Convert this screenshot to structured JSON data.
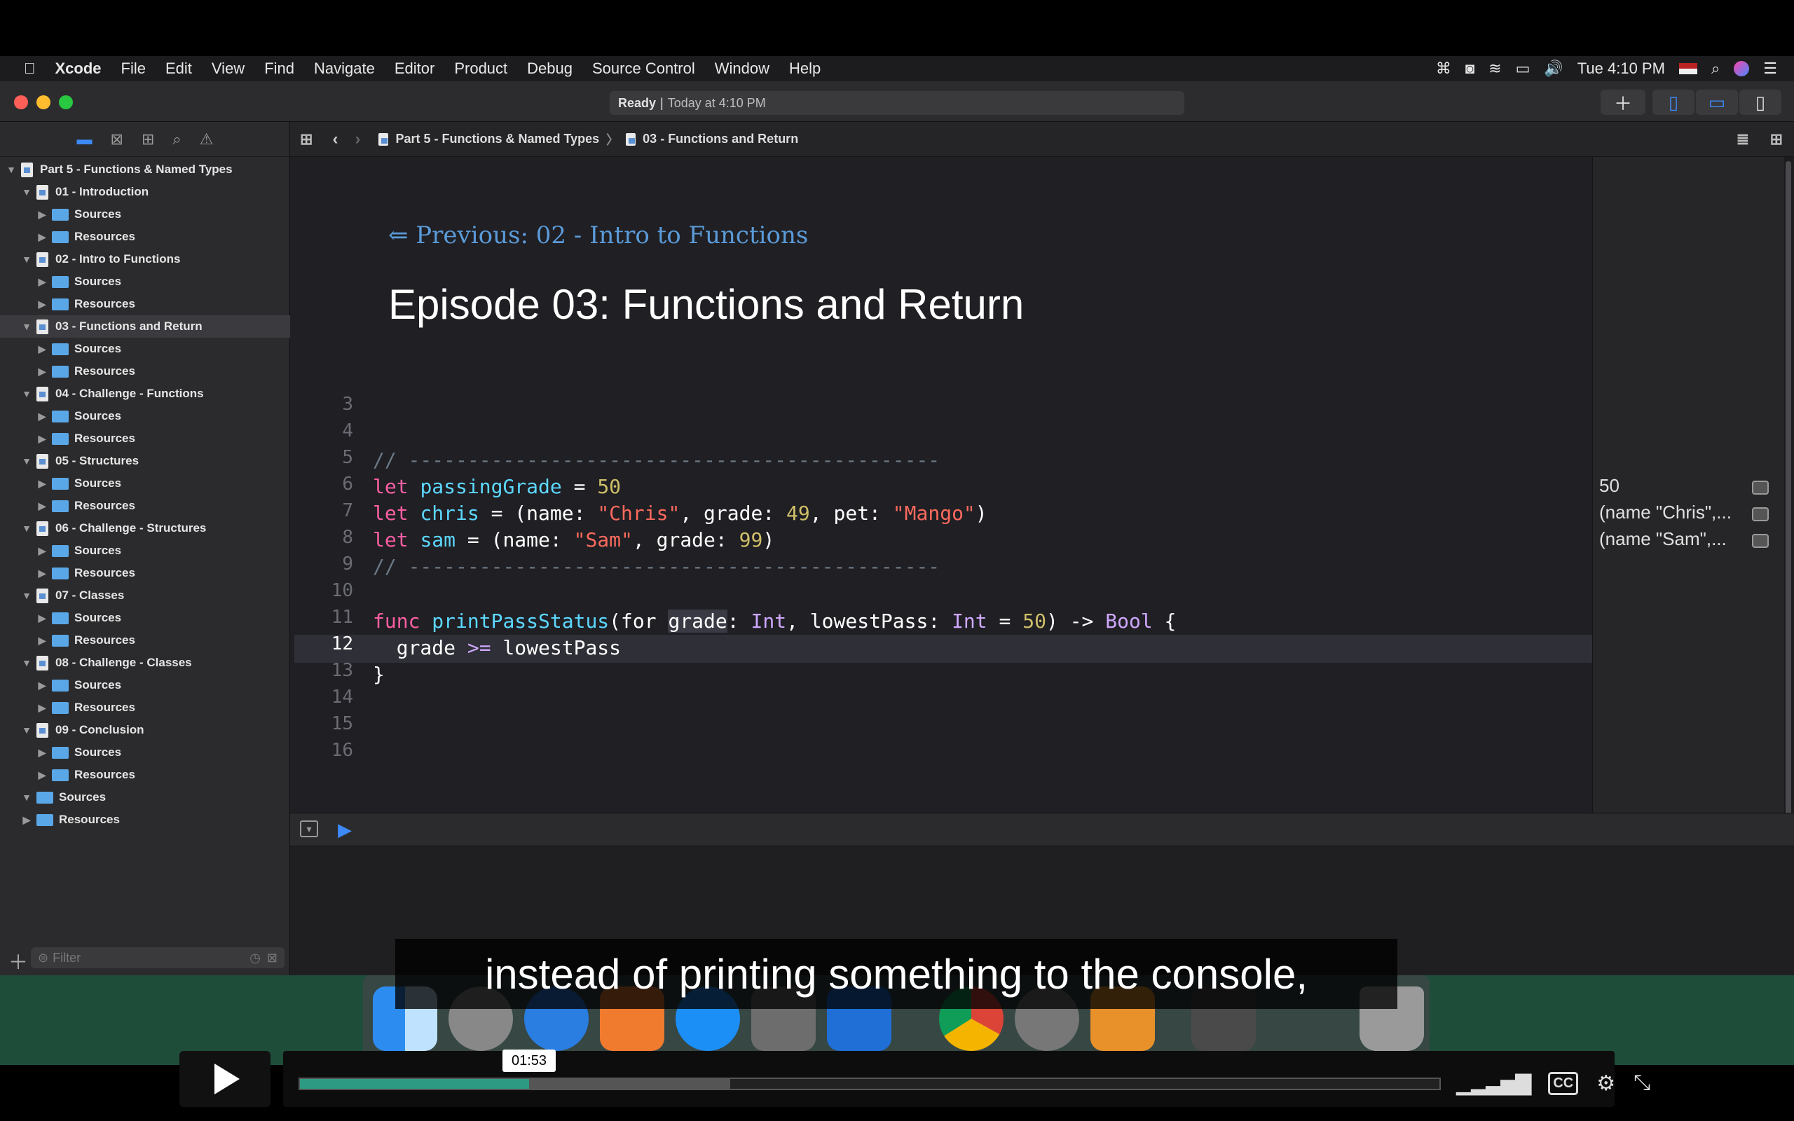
{
  "menubar": {
    "apple": "",
    "items": [
      "Xcode",
      "File",
      "Edit",
      "View",
      "Find",
      "Navigate",
      "Editor",
      "Product",
      "Debug",
      "Source Control",
      "Window",
      "Help"
    ],
    "clock": "Tue 4:10 PM"
  },
  "activity": {
    "status": "Ready",
    "time": "Today at 4:10 PM"
  },
  "navigator": {
    "project": "Part 5 - Functions & Named Types",
    "tree": [
      {
        "label": "Part 5 - Functions & Named Types",
        "kind": "doc",
        "indent": 0,
        "open": true
      },
      {
        "label": "01 - Introduction",
        "kind": "doc",
        "indent": 1,
        "open": true
      },
      {
        "label": "Sources",
        "kind": "folder",
        "indent": 2
      },
      {
        "label": "Resources",
        "kind": "folder",
        "indent": 2
      },
      {
        "label": "02 - Intro to Functions",
        "kind": "doc",
        "indent": 1,
        "open": true
      },
      {
        "label": "Sources",
        "kind": "folder",
        "indent": 2
      },
      {
        "label": "Resources",
        "kind": "folder",
        "indent": 2
      },
      {
        "label": "03 - Functions and Return",
        "kind": "doc",
        "indent": 1,
        "open": true,
        "selected": true
      },
      {
        "label": "Sources",
        "kind": "folder",
        "indent": 2
      },
      {
        "label": "Resources",
        "kind": "folder",
        "indent": 2
      },
      {
        "label": "04 - Challenge - Functions",
        "kind": "doc",
        "indent": 1,
        "open": true
      },
      {
        "label": "Sources",
        "kind": "folder",
        "indent": 2
      },
      {
        "label": "Resources",
        "kind": "folder",
        "indent": 2
      },
      {
        "label": "05 - Structures",
        "kind": "doc",
        "indent": 1,
        "open": true
      },
      {
        "label": "Sources",
        "kind": "folder",
        "indent": 2
      },
      {
        "label": "Resources",
        "kind": "folder",
        "indent": 2
      },
      {
        "label": "06 - Challenge - Structures",
        "kind": "doc",
        "indent": 1,
        "open": true
      },
      {
        "label": "Sources",
        "kind": "folder",
        "indent": 2
      },
      {
        "label": "Resources",
        "kind": "folder",
        "indent": 2
      },
      {
        "label": "07 - Classes",
        "kind": "doc",
        "indent": 1,
        "open": true
      },
      {
        "label": "Sources",
        "kind": "folder",
        "indent": 2
      },
      {
        "label": "Resources",
        "kind": "folder",
        "indent": 2
      },
      {
        "label": "08 - Challenge - Classes",
        "kind": "doc",
        "indent": 1,
        "open": true
      },
      {
        "label": "Sources",
        "kind": "folder",
        "indent": 2
      },
      {
        "label": "Resources",
        "kind": "folder",
        "indent": 2
      },
      {
        "label": "09 - Conclusion",
        "kind": "doc",
        "indent": 1,
        "open": true
      },
      {
        "label": "Sources",
        "kind": "folder",
        "indent": 2
      },
      {
        "label": "Resources",
        "kind": "folder",
        "indent": 2
      },
      {
        "label": "Sources",
        "kind": "folder",
        "indent": 1,
        "open": true
      },
      {
        "label": "Resources",
        "kind": "folder",
        "indent": 1
      }
    ],
    "filter_placeholder": "Filter"
  },
  "jumpbar": {
    "crumb1": "Part 5 - Functions & Named Types",
    "crumb2": "03 - Functions and Return"
  },
  "editor": {
    "prev_link": "⇐ Previous: 02 - Intro to Functions",
    "heading": "Episode 03: Functions and Return",
    "line_numbers": [
      "3",
      "4",
      "5",
      "6",
      "7",
      "8",
      "9",
      "10",
      "11",
      "12",
      "13",
      "14",
      "15",
      "16"
    ],
    "current_line": "12"
  },
  "results": [
    {
      "text": "50"
    },
    {
      "text": "(name \"Chris\",..."
    },
    {
      "text": "(name \"Sam\",..."
    }
  ],
  "caption": "instead of printing something to the console,",
  "player": {
    "time": "01:53",
    "progress": 0.201,
    "buffered": 0.377,
    "cc": "CC"
  },
  "colors": {
    "keyword": "#fc5fa3",
    "identifier": "#5dd8ff",
    "string": "#fc6a5d",
    "number": "#d0bf69",
    "comment": "#6c7986",
    "type": "#d0a8ff",
    "accent": "#3d8af7",
    "progress": "#2d9b83"
  }
}
